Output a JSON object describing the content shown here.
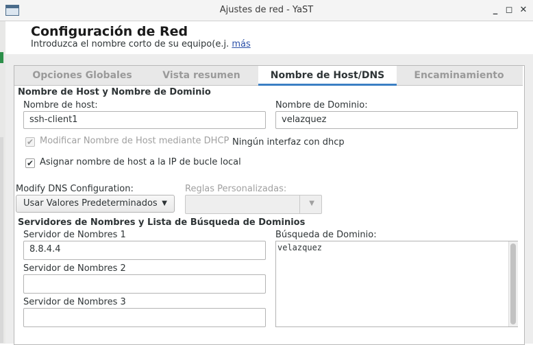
{
  "window": {
    "title": "Ajustes de red - YaST",
    "minimize_glyph": "_",
    "maximize_glyph": "◻",
    "close_glyph": "✕"
  },
  "header": {
    "title": "Configuración de Red",
    "subtitle": "Introduzca el nombre corto de su equipo(e.j.",
    "more_link": "más"
  },
  "tabs": [
    {
      "label": "Opciones Globales"
    },
    {
      "label": "Vista resumen"
    },
    {
      "label": "Nombre de Host/DNS"
    },
    {
      "label": "Encaminamiento"
    }
  ],
  "host_section": {
    "title": "Nombre de Host y Nombre de Dominio",
    "hostname_label": "Nombre de host:",
    "hostname_value": "ssh-client1",
    "domain_label": "Nombre de Dominio:",
    "domain_value": "velazquez",
    "dhcp_checkbox_label": "Modificar Nombre de Host mediante DHCP",
    "dhcp_checkbox_checked": "✔",
    "dhcp_note": "Ningún interfaz con dhcp",
    "loopback_checkbox_label": "Asignar nombre de host a la IP de bucle local",
    "loopback_checkbox_checked": "✔"
  },
  "dns_config": {
    "label": "Modify DNS Configuration:",
    "selected": "Usar Valores Predeterminados",
    "arrow": "▼",
    "custom_rules_label": "Reglas Personalizadas:",
    "custom_rules_value": "",
    "custom_arrow": "▼"
  },
  "servers_section": {
    "title": "Servidores de Nombres y Lista de Búsqueda de Dominios",
    "ns1_label": "Servidor de Nombres 1",
    "ns1_value": "8.8.4.4",
    "ns2_label": "Servidor de Nombres 2",
    "ns2_value": "",
    "ns3_label": "Servidor de Nombres 3",
    "ns3_value": "",
    "search_label": "Búsqueda de Dominio:",
    "search_value": "velazquez"
  },
  "colors": {
    "accent": "#3b7fc4",
    "link": "#2a4fa8"
  }
}
